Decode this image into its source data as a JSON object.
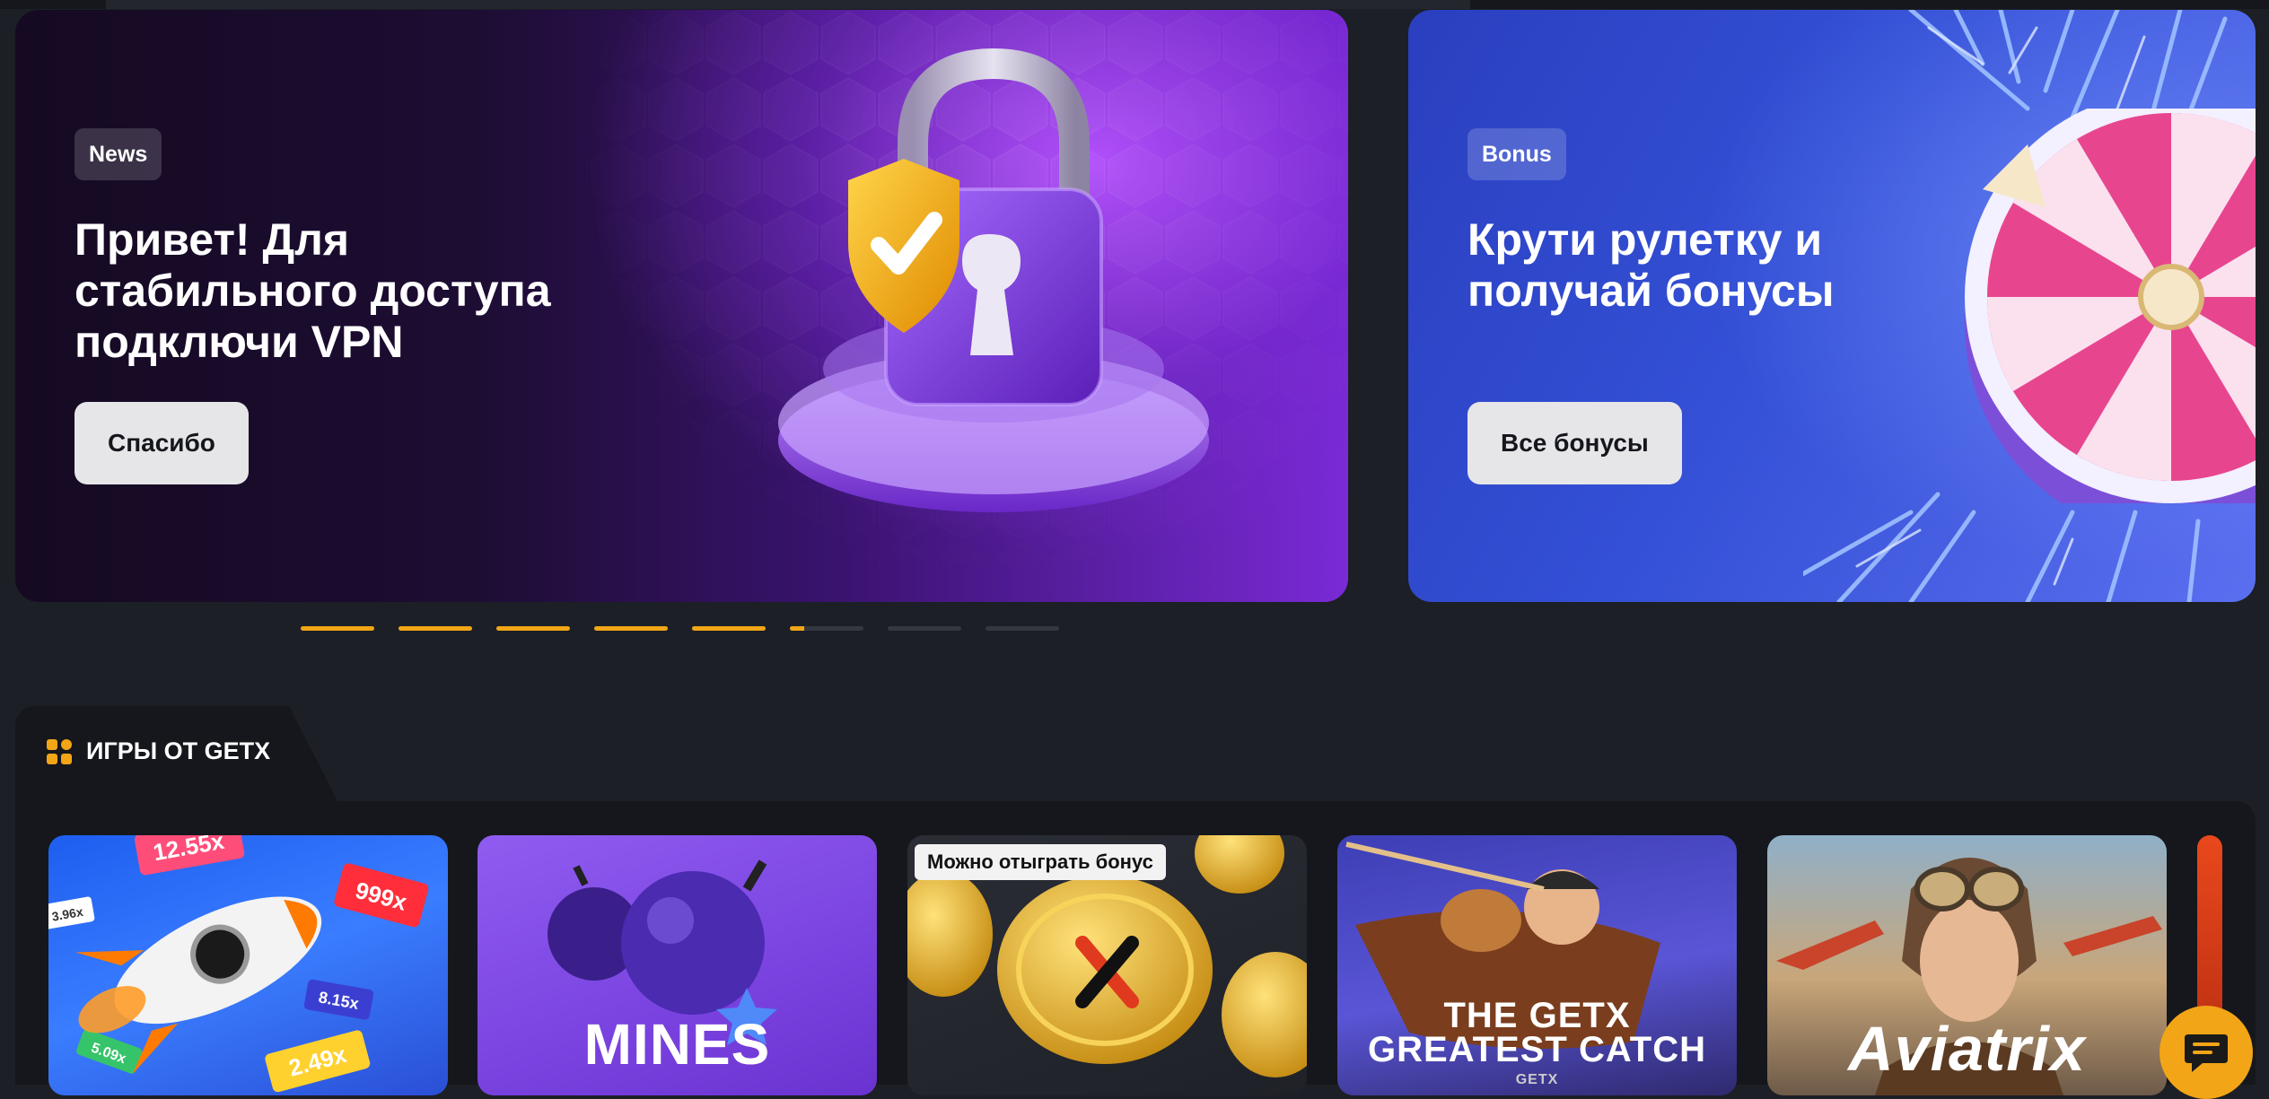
{
  "banners": [
    {
      "badge": "News",
      "title": "Привет! Для\nстабильного доступа\nподключи VPN",
      "button": "Спасибо",
      "art_icon": "padlock-shield-icon"
    },
    {
      "badge": "Bonus",
      "title": "Крути рулетку и\nполучай бонусы",
      "button": "Все бонусы",
      "art_icon": "prize-wheel-icon"
    }
  ],
  "pagination": {
    "total": 8,
    "active_index": 5,
    "active_progress": 0.2,
    "accent_color": "#f2a516"
  },
  "games_section": {
    "title": "ИГРЫ ОТ GETX",
    "icon": "games-grid-icon",
    "cards": [
      {
        "title": "",
        "image_icon": "rocket-multiplier-icon",
        "multipliers": [
          "12.55x",
          "999x",
          "3.96x",
          "8.15x",
          "5.09x",
          "2.49x"
        ]
      },
      {
        "title": "MINES",
        "image_icon": "bombs-icon"
      },
      {
        "title": "",
        "image_icon": "gold-coin-icon",
        "promo_badge": "Можно отыграть бонус"
      },
      {
        "title": "THE GETX\nGREATEST CATCH",
        "subtitle": "GETX",
        "image_icon": "fisherman-boat-icon"
      },
      {
        "title": "Aviatrix",
        "image_icon": "pilot-girl-icon"
      }
    ]
  },
  "chat_button": {
    "icon": "chat-bubble-icon"
  },
  "colors": {
    "background": "#1c1f25",
    "panel": "#15171c",
    "accent": "#f2a516",
    "news_purple": "#7a2ad6",
    "bonus_blue": "#3450d6"
  }
}
